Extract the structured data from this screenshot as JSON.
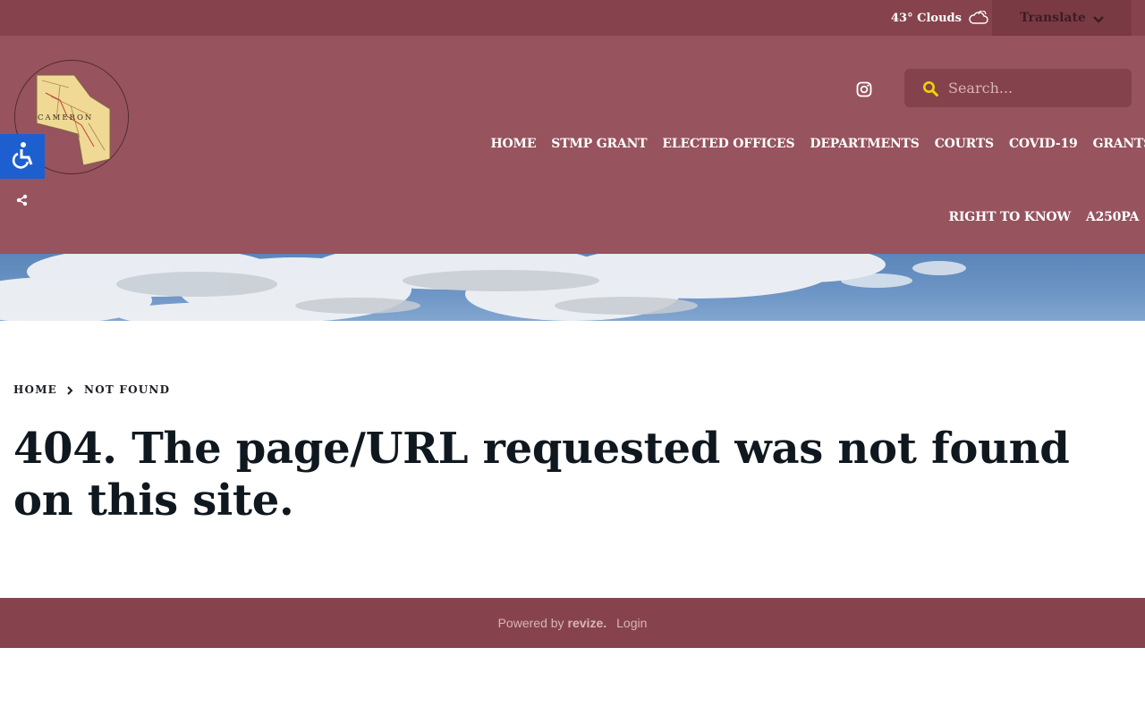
{
  "topbar": {
    "weather_text": "43° Clouds",
    "weather_icon": "cloud-icon",
    "translate_label": "Translate"
  },
  "header": {
    "search_placeholder": "Search...",
    "nav_items": [
      {
        "label": "HOME"
      },
      {
        "label": "STMP GRANT"
      },
      {
        "label": "ELECTED OFFICES"
      },
      {
        "label": "DEPARTMENTS"
      },
      {
        "label": "COURTS"
      },
      {
        "label": "COVID-19"
      },
      {
        "label": "GRANTS"
      },
      {
        "label": "RIGHT TO KNOW"
      },
      {
        "label": "A250PA"
      }
    ]
  },
  "breadcrumb": {
    "home": "HOME",
    "current": "NOT FOUND"
  },
  "main": {
    "title": "404. The page/URL requested was not found on this site."
  },
  "footer": {
    "powered_by": "Powered by",
    "brand": "revize.",
    "login": "Login"
  },
  "colors": {
    "topbar_bg": "#86434d",
    "header_bg": "#97535e",
    "accessibility_blue": "#1d5fcf",
    "search_icon_yellow": "#f2d300"
  }
}
